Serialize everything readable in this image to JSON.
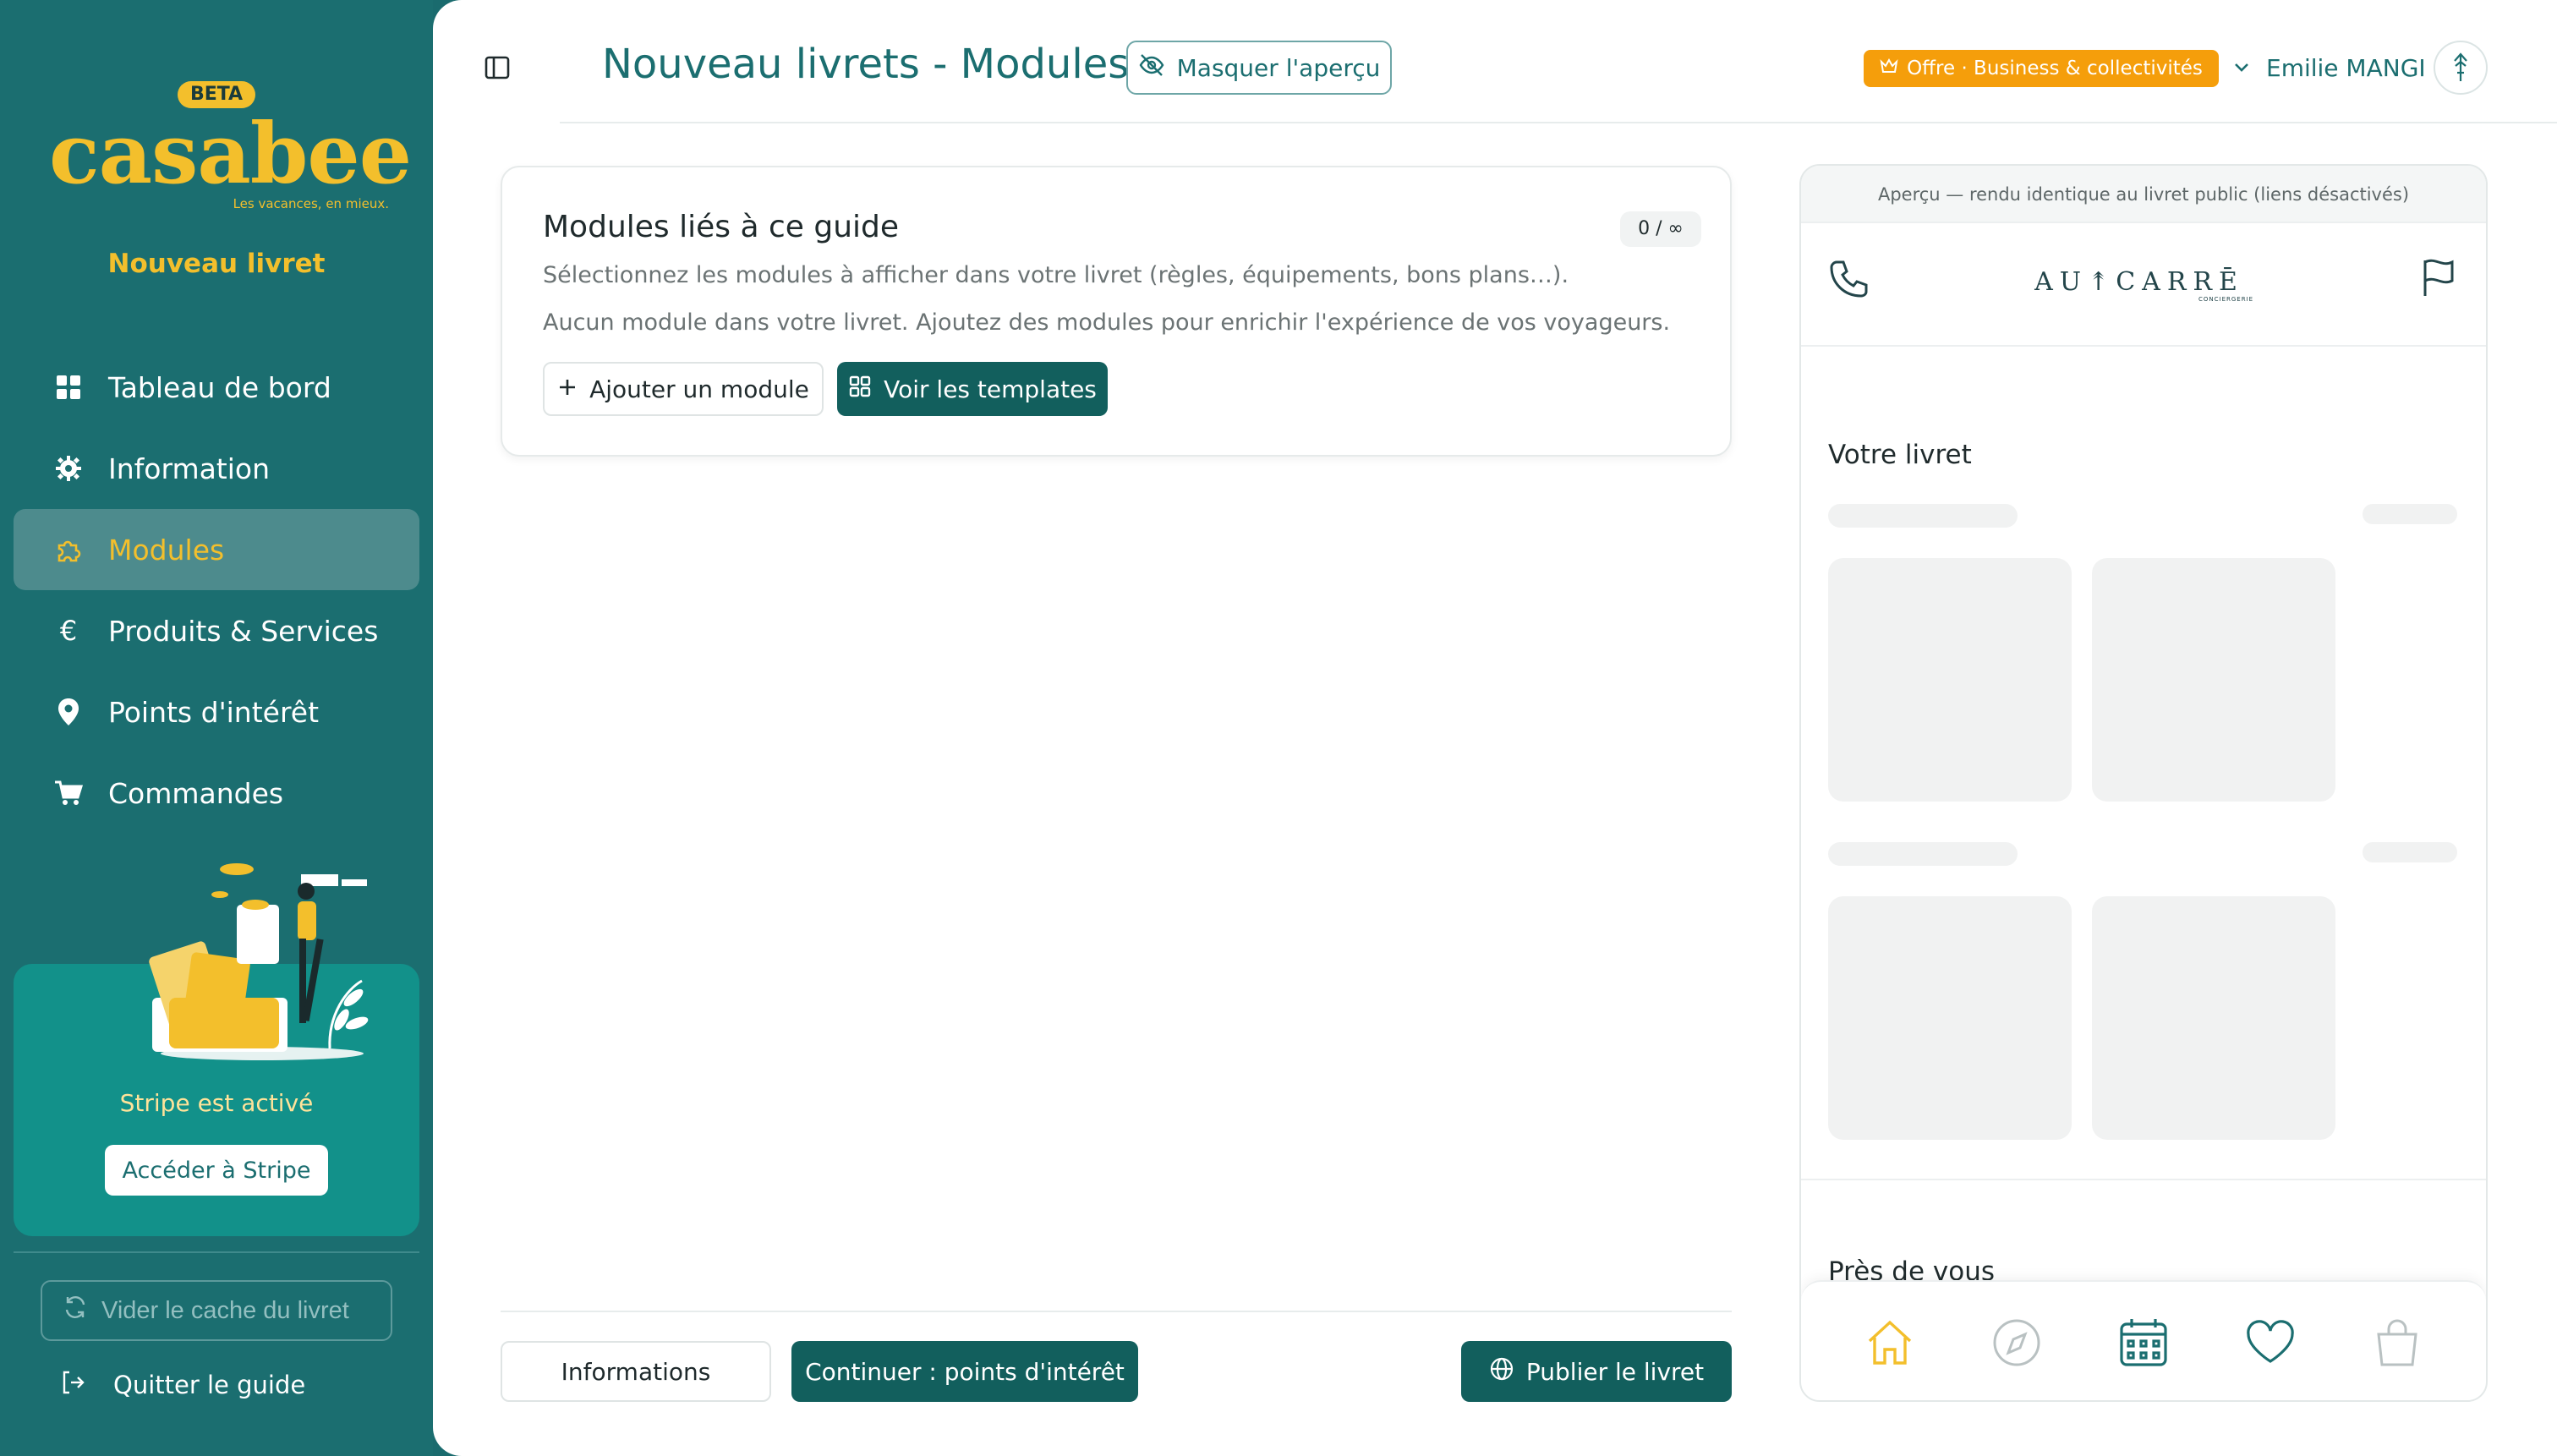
{
  "colors": {
    "sidebar_bg": "#1b6e70",
    "accent_yellow": "#f3bf2c",
    "primary_dark": "#125f5d",
    "offer_orange": "#f59e0b"
  },
  "sidebar": {
    "beta_badge": "BETA",
    "logo_text": "casabee",
    "logo_tagline": "Les vacances, en mieux.",
    "book_name": "Nouveau livret",
    "items": [
      {
        "label": "Tableau de bord",
        "icon": "grid-icon",
        "active": false
      },
      {
        "label": "Information",
        "icon": "gear-icon",
        "active": false
      },
      {
        "label": "Modules",
        "icon": "puzzle-icon",
        "active": true
      },
      {
        "label": "Produits & Services",
        "icon": "euro-icon",
        "active": false
      },
      {
        "label": "Points d'intérêt",
        "icon": "map-pin-icon",
        "active": false
      },
      {
        "label": "Commandes",
        "icon": "cart-icon",
        "active": false
      }
    ],
    "stripe": {
      "status": "Stripe est activé",
      "button": "Accéder à Stripe"
    },
    "cache_button": "Vider le cache du livret",
    "quit_label": "Quitter le guide"
  },
  "header": {
    "title": "Nouveau livrets - Modules",
    "hide_preview": "Masquer l'aperçu",
    "offer_badge": "Offre · Business & collectivités",
    "user_name": "Emilie MANGI"
  },
  "modules_card": {
    "title": "Modules liés à ce guide",
    "counter": "0 / ∞",
    "subtitle": "Sélectionnez les modules à afficher dans votre livret (règles, équipements, bons plans…).",
    "empty_text": "Aucun module dans votre livret. Ajoutez des modules pour enrichir l'expérience de vos voyageurs.",
    "add_button": "Ajouter un module",
    "templates_button": "Voir les templates"
  },
  "footer": {
    "info_button": "Informations",
    "continue_button": "Continuer : points d'intérêt",
    "publish_button": "Publier le livret"
  },
  "preview": {
    "caption": "Aperçu — rendu identique au livret public (liens désactivés)",
    "brand_logo": "AU↟CARRĒ",
    "brand_sub": "CONCIERGERIE",
    "section_title": "Votre livret",
    "near_title": "Près de vous",
    "bottom_nav": [
      "home-icon",
      "compass-icon",
      "calendar-icon",
      "heart-icon",
      "shopping-bag-icon"
    ]
  }
}
